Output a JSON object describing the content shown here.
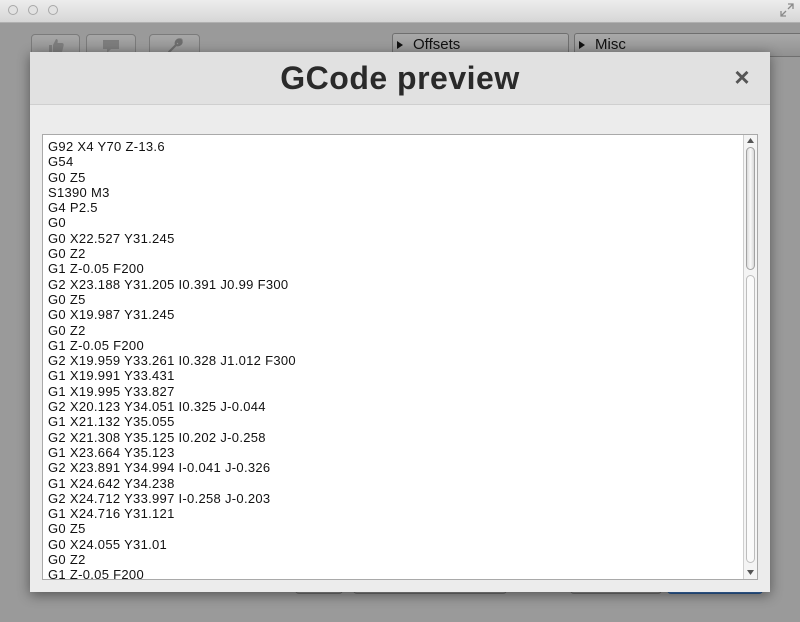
{
  "window": {
    "controls": [
      "close-button",
      "minimize-button",
      "zoom-button"
    ]
  },
  "background_app": {
    "panels": [
      {
        "label": "Offsets"
      },
      {
        "label": "Misc"
      }
    ]
  },
  "dialog": {
    "title": "GCode preview",
    "close_label": "×",
    "gcode_lines": [
      "G92 X4 Y70 Z-13.6",
      "G54",
      "G0 Z5",
      "S1390 M3",
      "G4 P2.5",
      "G0",
      "G0 X22.527 Y31.245",
      "G0 Z2",
      "G1 Z-0.05 F200",
      "G2 X23.188 Y31.205 I0.391 J0.99 F300",
      "G0 Z5",
      "G0 X19.987 Y31.245",
      "G0 Z2",
      "G1 Z-0.05 F200",
      "G2 X19.959 Y33.261 I0.328 J1.012 F300",
      "G1 X19.991 Y33.431",
      "G1 X19.995 Y33.827",
      "G2 X20.123 Y34.051 I0.325 J-0.044",
      "G1 X21.132 Y35.055",
      "G2 X21.308 Y35.125 I0.202 J-0.258",
      "G1 X23.664 Y35.123",
      "G2 X23.891 Y34.994 I-0.041 J-0.326",
      "G1 X24.642 Y34.238",
      "G2 X24.712 Y33.997 I-0.258 J-0.203",
      "G1 X24.716 Y31.121",
      "G0 Z5",
      "G0 X24.055 Y31.01",
      "G0 Z2",
      "G1 Z-0.05 F200"
    ]
  }
}
